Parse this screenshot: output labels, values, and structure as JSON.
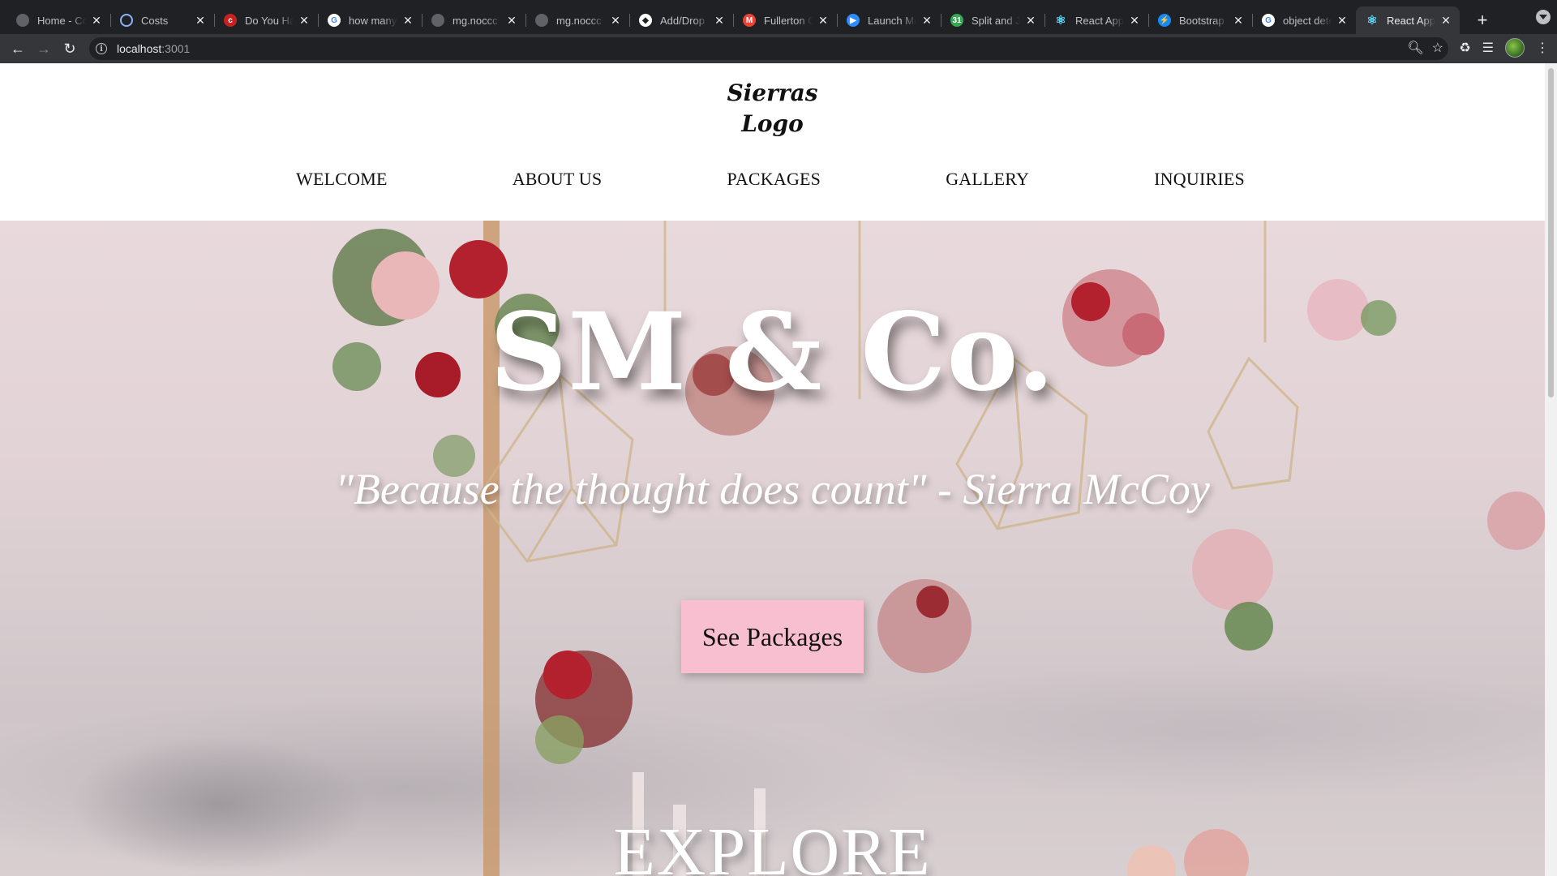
{
  "browser": {
    "tabs": [
      {
        "title": "Home - Co",
        "favicon": "circle-gray-icon",
        "color": "#5f6368",
        "active": false
      },
      {
        "title": "Costs",
        "favicon": "loading-ring-icon",
        "color": "#8ab4f8",
        "active": false
      },
      {
        "title": "Do You Hav",
        "favicon": "red-c-icon",
        "color": "#c5221f",
        "active": false
      },
      {
        "title": "how many",
        "favicon": "google-g-icon",
        "color": "#ffffff",
        "active": false
      },
      {
        "title": "mg.noccc",
        "favicon": "circle-gray-icon",
        "color": "#5f6368",
        "active": false
      },
      {
        "title": "mg.noccc",
        "favicon": "circle-gray-icon",
        "color": "#5f6368",
        "active": false
      },
      {
        "title": "Add/Drop C",
        "favicon": "diamond-icon",
        "color": "#ffffff",
        "active": false
      },
      {
        "title": "Fullerton C",
        "favicon": "gmail-icon",
        "color": "#ea4335",
        "active": false
      },
      {
        "title": "Launch Me",
        "favicon": "zoom-icon",
        "color": "#2d8cff",
        "active": false
      },
      {
        "title": "Split and J",
        "favicon": "calendar-icon",
        "color": "#34a853",
        "active": false
      },
      {
        "title": "React App",
        "favicon": "react-icon",
        "color": "#61dafb",
        "active": false
      },
      {
        "title": "Bootstrap",
        "favicon": "stackblitz-icon",
        "color": "#1389fd",
        "active": false
      },
      {
        "title": "object dete",
        "favicon": "google-g-icon",
        "color": "#ffffff",
        "active": false
      },
      {
        "title": "React App",
        "favicon": "react-icon",
        "color": "#61dafb",
        "active": true
      }
    ],
    "url_host": "localhost",
    "url_port": ":3001"
  },
  "site": {
    "logo_line1": "Sierras",
    "logo_line2": "Logo",
    "nav": [
      "WELCOME",
      "ABOUT US",
      "PACKAGES",
      "GALLERY",
      "INQUIRIES"
    ],
    "hero_title": "SM & Co.",
    "hero_quote": "\"Because the thought does count\" - Sierra McCoy",
    "cta_label": "See Packages",
    "section_title": "EXPLORE"
  },
  "colors": {
    "cta_bg": "#f7bfcf",
    "hero_text": "#ffffff"
  }
}
